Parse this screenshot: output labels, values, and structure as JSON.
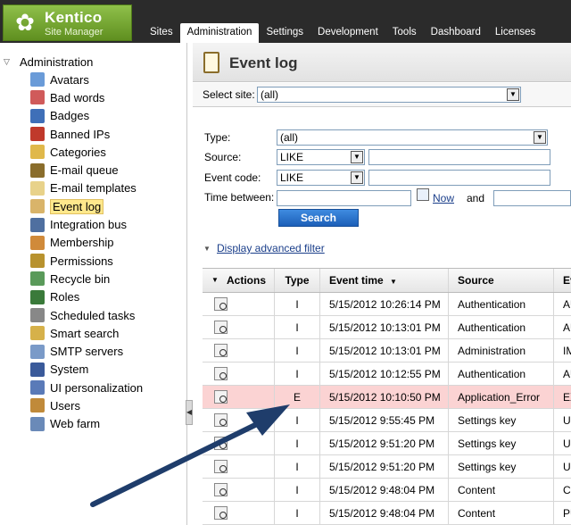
{
  "header": {
    "brand": "Kentico",
    "sub": "Site Manager",
    "tabs": [
      {
        "label": "Sites",
        "active": false
      },
      {
        "label": "Administration",
        "active": true
      },
      {
        "label": "Settings",
        "active": false
      },
      {
        "label": "Development",
        "active": false
      },
      {
        "label": "Tools",
        "active": false
      },
      {
        "label": "Dashboard",
        "active": false
      },
      {
        "label": "Licenses",
        "active": false
      }
    ]
  },
  "sidebar": {
    "root": "Administration",
    "items": [
      {
        "label": "Avatars",
        "icon": "avatars-icon",
        "color": "#6a9bd8"
      },
      {
        "label": "Bad words",
        "icon": "bad-words-icon",
        "color": "#d05a5a"
      },
      {
        "label": "Badges",
        "icon": "badges-icon",
        "color": "#3f6fb8"
      },
      {
        "label": "Banned IPs",
        "icon": "banned-ips-icon",
        "color": "#c0392b"
      },
      {
        "label": "Categories",
        "icon": "categories-icon",
        "color": "#e0b84a"
      },
      {
        "label": "E-mail queue",
        "icon": "email-queue-icon",
        "color": "#8a6d2b"
      },
      {
        "label": "E-mail templates",
        "icon": "email-templates-icon",
        "color": "#e8d28a"
      },
      {
        "label": "Event log",
        "icon": "event-log-icon",
        "color": "#d9b46a",
        "selected": true
      },
      {
        "label": "Integration bus",
        "icon": "integration-bus-icon",
        "color": "#4f6fa0"
      },
      {
        "label": "Membership",
        "icon": "membership-icon",
        "color": "#d08a3a"
      },
      {
        "label": "Permissions",
        "icon": "permissions-icon",
        "color": "#b8922e"
      },
      {
        "label": "Recycle bin",
        "icon": "recycle-bin-icon",
        "color": "#5a9a5a"
      },
      {
        "label": "Roles",
        "icon": "roles-icon",
        "color": "#3a7a3a"
      },
      {
        "label": "Scheduled tasks",
        "icon": "scheduled-tasks-icon",
        "color": "#888888"
      },
      {
        "label": "Smart search",
        "icon": "smart-search-icon",
        "color": "#d6b14a"
      },
      {
        "label": "SMTP servers",
        "icon": "smtp-servers-icon",
        "color": "#7a9ac8"
      },
      {
        "label": "System",
        "icon": "system-icon",
        "color": "#3a5a9a"
      },
      {
        "label": "UI personalization",
        "icon": "ui-personalization-icon",
        "color": "#5a7ab8"
      },
      {
        "label": "Users",
        "icon": "users-icon",
        "color": "#c08a3a"
      },
      {
        "label": "Web farm",
        "icon": "web-farm-icon",
        "color": "#6a8ab8"
      }
    ]
  },
  "main": {
    "title": "Event log",
    "select_site_label": "Select site:",
    "select_site_value": "(all)",
    "filter": {
      "type_label": "Type:",
      "type_value": "(all)",
      "source_label": "Source:",
      "source_op": "LIKE",
      "code_label": "Event code:",
      "code_op": "LIKE",
      "time_label": "Time between:",
      "now_label": "Now",
      "and_label": "and",
      "search_label": "Search",
      "advanced_label": "Display advanced filter"
    },
    "grid": {
      "columns": [
        "Actions",
        "Type",
        "Event time",
        "Source",
        "Ev"
      ],
      "rows": [
        {
          "type": "I",
          "time": "5/15/2012 10:26:14 PM",
          "source": "Authentication",
          "ev": "AU"
        },
        {
          "type": "I",
          "time": "5/15/2012 10:13:01 PM",
          "source": "Authentication",
          "ev": "AU"
        },
        {
          "type": "I",
          "time": "5/15/2012 10:13:01 PM",
          "source": "Administration",
          "ev": "IM"
        },
        {
          "type": "I",
          "time": "5/15/2012 10:12:55 PM",
          "source": "Authentication",
          "ev": "AU"
        },
        {
          "type": "E",
          "time": "5/15/2012 10:10:50 PM",
          "source": "Application_Error",
          "ev": "EX",
          "error": true
        },
        {
          "type": "I",
          "time": "5/15/2012 9:55:45 PM",
          "source": "Settings key",
          "ev": "UP"
        },
        {
          "type": "I",
          "time": "5/15/2012 9:51:20 PM",
          "source": "Settings key",
          "ev": "UP"
        },
        {
          "type": "I",
          "time": "5/15/2012 9:51:20 PM",
          "source": "Settings key",
          "ev": "UP"
        },
        {
          "type": "I",
          "time": "5/15/2012 9:48:04 PM",
          "source": "Content",
          "ev": "CH"
        },
        {
          "type": "I",
          "time": "5/15/2012 9:48:04 PM",
          "source": "Content",
          "ev": "PU"
        }
      ]
    }
  },
  "colors": {
    "arrow": "#1f3d6b",
    "error_row": "#fbd3d3",
    "header_bg": "#2b2b2b",
    "brand_green": "#6fa22f"
  }
}
